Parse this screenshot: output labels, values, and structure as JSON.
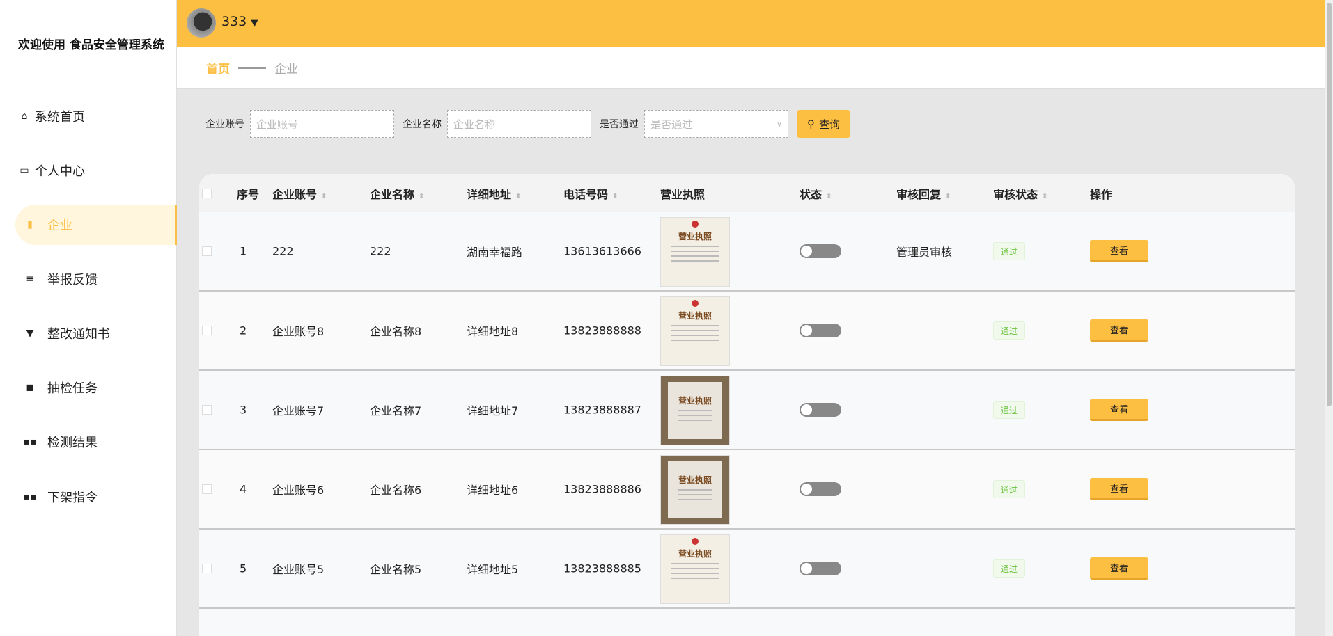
{
  "sidebar": {
    "title": "欢迎使用 食品安全管理系统",
    "items": [
      {
        "label": "系统首页",
        "icon": "home-icon"
      },
      {
        "label": "个人中心",
        "icon": "wallet-icon"
      },
      {
        "label": "企业",
        "icon": "bar-chart-icon",
        "active": true
      },
      {
        "label": "举报反馈",
        "icon": "list-icon"
      },
      {
        "label": "整改通知书",
        "icon": "brush-icon"
      },
      {
        "label": "抽检任务",
        "icon": "wallet-icon"
      },
      {
        "label": "检测结果",
        "icon": "grid-icon"
      },
      {
        "label": "下架指令",
        "icon": "grid-icon"
      }
    ]
  },
  "header": {
    "username": "333"
  },
  "breadcrumb": {
    "home": "首页",
    "current": "企业"
  },
  "search": {
    "account_label": "企业账号",
    "account_placeholder": "企业账号",
    "name_label": "企业名称",
    "name_placeholder": "企业名称",
    "pass_label": "是否通过",
    "pass_placeholder": "是否通过",
    "button": "查询"
  },
  "table": {
    "headers": [
      "序号",
      "企业账号",
      "企业名称",
      "详细地址",
      "电话号码",
      "营业执照",
      "状态",
      "审核回复",
      "审核状态",
      "操作"
    ],
    "rows": [
      {
        "no": "1",
        "account": "222",
        "name": "222",
        "address": "湖南幸福路",
        "phone": "13613613666",
        "reply": "管理员审核",
        "audit": "通过",
        "action": "查看"
      },
      {
        "no": "2",
        "account": "企业账号8",
        "name": "企业名称8",
        "address": "详细地址8",
        "phone": "13823888888",
        "reply": "",
        "audit": "通过",
        "action": "查看"
      },
      {
        "no": "3",
        "account": "企业账号7",
        "name": "企业名称7",
        "address": "详细地址7",
        "phone": "13823888887",
        "reply": "",
        "audit": "通过",
        "action": "查看"
      },
      {
        "no": "4",
        "account": "企业账号6",
        "name": "企业名称6",
        "address": "详细地址6",
        "phone": "13823888886",
        "reply": "",
        "audit": "通过",
        "action": "查看"
      },
      {
        "no": "5",
        "account": "企业账号5",
        "name": "企业名称5",
        "address": "详细地址5",
        "phone": "13823888885",
        "reply": "",
        "audit": "通过",
        "action": "查看"
      }
    ],
    "license_text": "营业执照"
  },
  "colors": {
    "accent": "#fdbf42",
    "pass": "#67c23a"
  }
}
